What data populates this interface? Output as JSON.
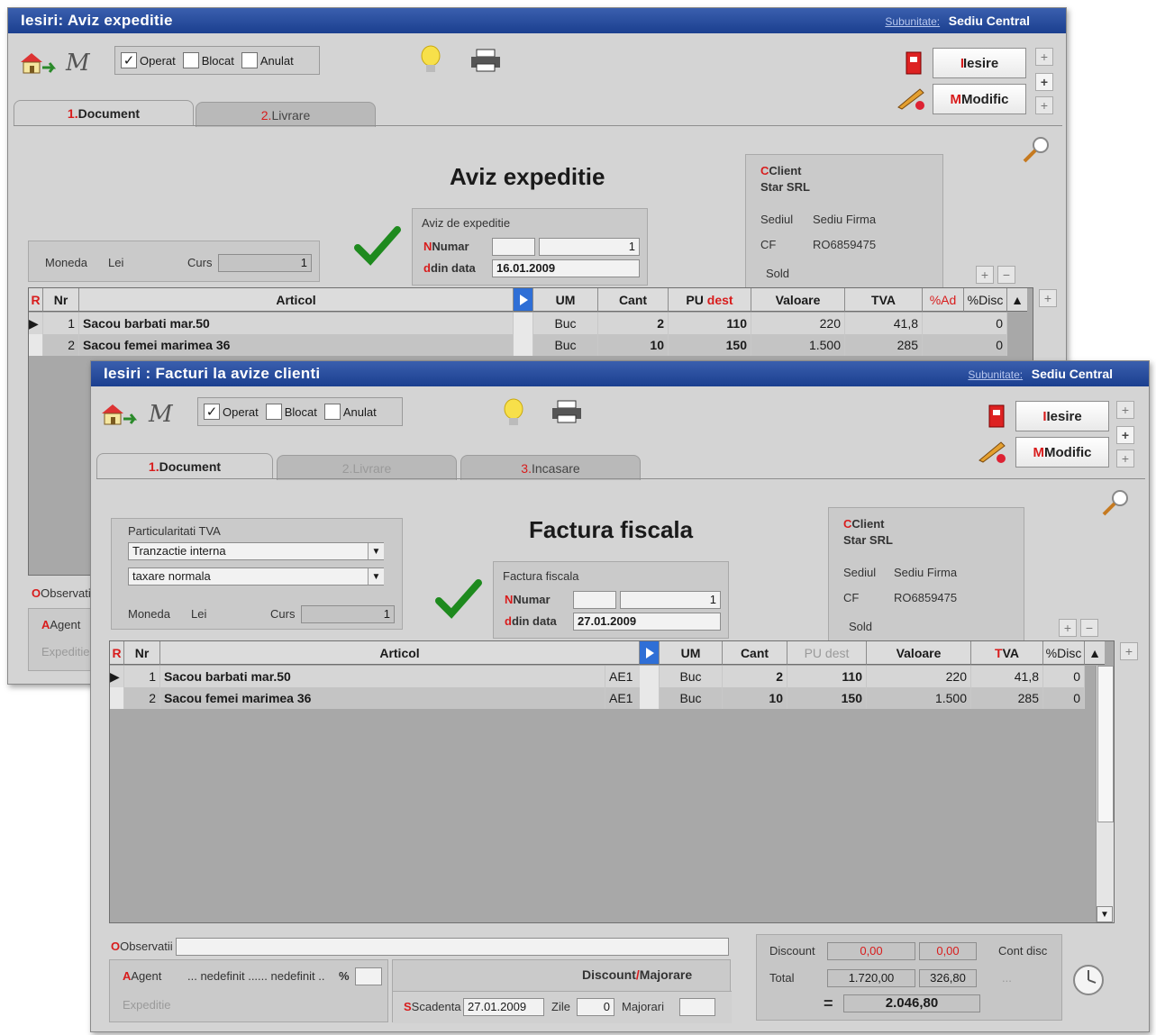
{
  "window1": {
    "title": "Iesiri: Aviz expeditie",
    "subunit_label": "Subunitate:",
    "subunit_value": "Sediu Central",
    "flags": {
      "operat": "Operat",
      "blocat": "Blocat",
      "anulat": "Anulat"
    },
    "buttons": {
      "iesire": "Iesire",
      "modific": "Modific"
    },
    "tabs": [
      {
        "num": "1.",
        "label": "Document"
      },
      {
        "num": "2.",
        "label": "Livrare"
      }
    ],
    "doc_title": "Aviz expeditie",
    "doc_type_label": "Aviz de expeditie",
    "numar_label": "Numar",
    "numar_value": "1",
    "din_data_label": "din data",
    "din_data_value": "16.01.2009",
    "moneda_label": "Moneda",
    "moneda_value": "Lei",
    "curs_label": "Curs",
    "curs_value": "1",
    "client_label": "Client",
    "client_name": "Star SRL",
    "sediul_label": "Sediul",
    "sediul_value": "Sediu Firma",
    "cf_label": "CF",
    "cf_value": "RO6859475",
    "sold_label": "Sold",
    "observatii_label": "Observatii",
    "agent_label": "Agent",
    "expeditie_label": "Expeditie",
    "columns": [
      "R",
      "Nr",
      "Articol",
      "UM",
      "Cant",
      "PU dest",
      "Valoare",
      "TVA",
      "%Ad",
      "%Disc"
    ],
    "rows": [
      {
        "nr": "1",
        "articol": "Sacou barbati mar.50",
        "um": "Buc",
        "cant": "2",
        "pu": "110",
        "valoare": "220",
        "tva": "41,8",
        "disc": "0"
      },
      {
        "nr": "2",
        "articol": "Sacou femei marimea 36",
        "um": "Buc",
        "cant": "10",
        "pu": "150",
        "valoare": "1.500",
        "tva": "285",
        "disc": "0"
      }
    ]
  },
  "window2": {
    "title": "Iesiri : Facturi la avize clienti",
    "subunit_label": "Subunitate:",
    "subunit_value": "Sediu Central",
    "flags": {
      "operat": "Operat",
      "blocat": "Blocat",
      "anulat": "Anulat"
    },
    "buttons": {
      "iesire": "Iesire",
      "modific": "Modific"
    },
    "tabs": [
      {
        "num": "1.",
        "label": "Document"
      },
      {
        "num": "2.",
        "label": "Livrare"
      },
      {
        "num": "3.",
        "label": "Incasare"
      }
    ],
    "tva_box_label": "Particularitati TVA",
    "tva_option1": "Tranzactie interna",
    "tva_option2": "taxare normala",
    "moneda_label": "Moneda",
    "moneda_value": "Lei",
    "curs_label": "Curs",
    "curs_value": "1",
    "doc_title": "Factura fiscala",
    "doc_type_label": "Factura fiscala",
    "numar_label": "Numar",
    "numar_value": "1",
    "din_data_label": "din data",
    "din_data_value": "27.01.2009",
    "client_label": "Client",
    "client_name": "Star SRL",
    "sediul_label": "Sediul",
    "sediul_value": "Sediu Firma",
    "cf_label": "CF",
    "cf_value": "RO6859475",
    "sold_label": "Sold",
    "columns": [
      "R",
      "Nr",
      "Articol",
      "UM",
      "Cant",
      "PU dest",
      "Valoare",
      "TVA",
      "%Disc"
    ],
    "rows": [
      {
        "nr": "1",
        "articol": "Sacou barbati mar.50",
        "code": "AE1",
        "um": "Buc",
        "cant": "2",
        "pu": "110",
        "valoare": "220",
        "tva": "41,8",
        "disc": "0"
      },
      {
        "nr": "2",
        "articol": "Sacou femei marimea 36",
        "code": "AE1",
        "um": "Buc",
        "cant": "10",
        "pu": "150",
        "valoare": "1.500",
        "tva": "285",
        "disc": "0"
      }
    ],
    "observatii_label": "Observatii",
    "agent_label": "Agent",
    "agent_value": "... nedefinit ...... nedefinit ..",
    "expeditie_label": "Expeditie",
    "discount_majorare_label_a": "Discount",
    "discount_majorare_sep": "/",
    "discount_majorare_label_b": "Majorare",
    "scadenta_label": "Scadenta",
    "scadenta_value": "27.01.2009",
    "zile_label": "Zile",
    "zile_value": "0",
    "majorari_label": "Majorari",
    "discount_label": "Discount",
    "discount_value1": "0,00",
    "discount_value2": "0,00",
    "total_label": "Total",
    "total_value1": "1.720,00",
    "total_value2": "326,80",
    "cont_disc_label": "Cont disc",
    "cont_disc_value": "...",
    "equals": "=",
    "grand_total": "2.046,80"
  }
}
